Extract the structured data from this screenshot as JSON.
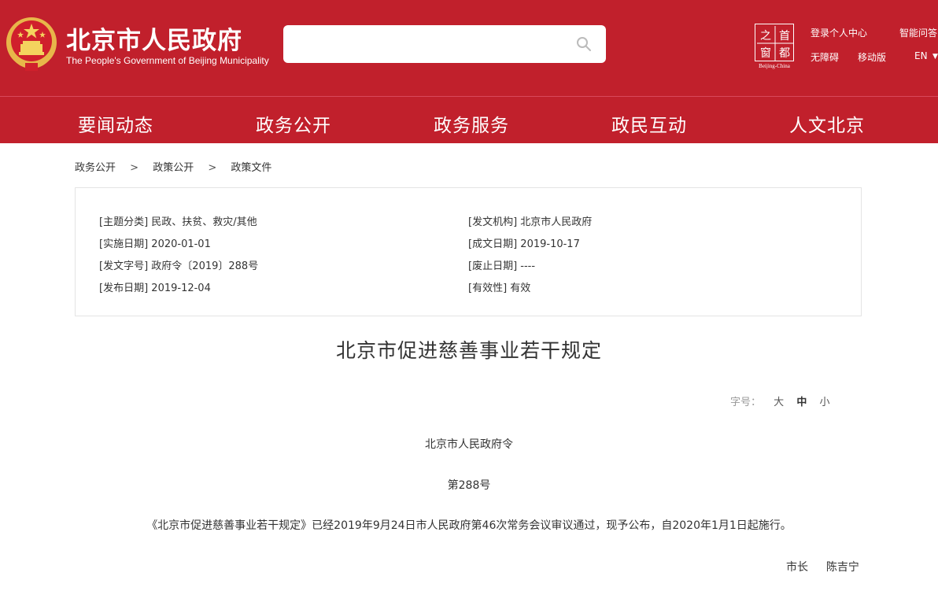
{
  "header": {
    "title_cn": "北京市人民政府",
    "title_en": "The People's Government of Beijing Municipality",
    "search": {
      "placeholder": ""
    },
    "capital_logo": {
      "chars": [
        "之",
        "首",
        "窗",
        "都"
      ],
      "caption": "Beijing-China"
    },
    "links": {
      "login": "登录个人中心",
      "smart_qa": "智能问答",
      "accessibility": "无障碍",
      "mobile": "移动版",
      "language": "EN"
    },
    "colors": {
      "brand_red": "#c1202c",
      "text_on_brand": "#ffffff"
    }
  },
  "nav": {
    "items": [
      "要闻动态",
      "政务公开",
      "政务服务",
      "政民互动",
      "人文北京"
    ]
  },
  "breadcrumb": {
    "items": [
      "政务公开",
      "政策公开",
      "政策文件"
    ],
    "separator": ">"
  },
  "meta": {
    "topic": {
      "label": "[主题分类]",
      "value": "民政、扶贫、救灾/其他"
    },
    "issuer": {
      "label": "[发文机构]",
      "value": "北京市人民政府"
    },
    "effective_date": {
      "label": "[实施日期]",
      "value": "2020-01-01"
    },
    "written_date": {
      "label": "[成文日期]",
      "value": "2019-10-17"
    },
    "doc_number": {
      "label": "[发文字号]",
      "value": "政府令〔2019〕288号"
    },
    "repeal_date": {
      "label": "[废止日期]",
      "value": "----"
    },
    "publish_date": {
      "label": "[发布日期]",
      "value": "2019-12-04"
    },
    "validity": {
      "label": "[有效性]",
      "value": "有效"
    }
  },
  "document": {
    "title": "北京市促进慈善事业若干规定",
    "font_size": {
      "label": "字号：",
      "options": [
        "大",
        "中",
        "小"
      ],
      "selected": "中"
    },
    "order_line": "北京市人民政府令",
    "number_line": "第288号",
    "paragraph": "《北京市促进慈善事业若干规定》已经2019年9月24日市人民政府第46次常务会议审议通过，现予公布，自2020年1月1日起施行。",
    "signature_title": "市长",
    "signature_name": "陈吉宁"
  }
}
